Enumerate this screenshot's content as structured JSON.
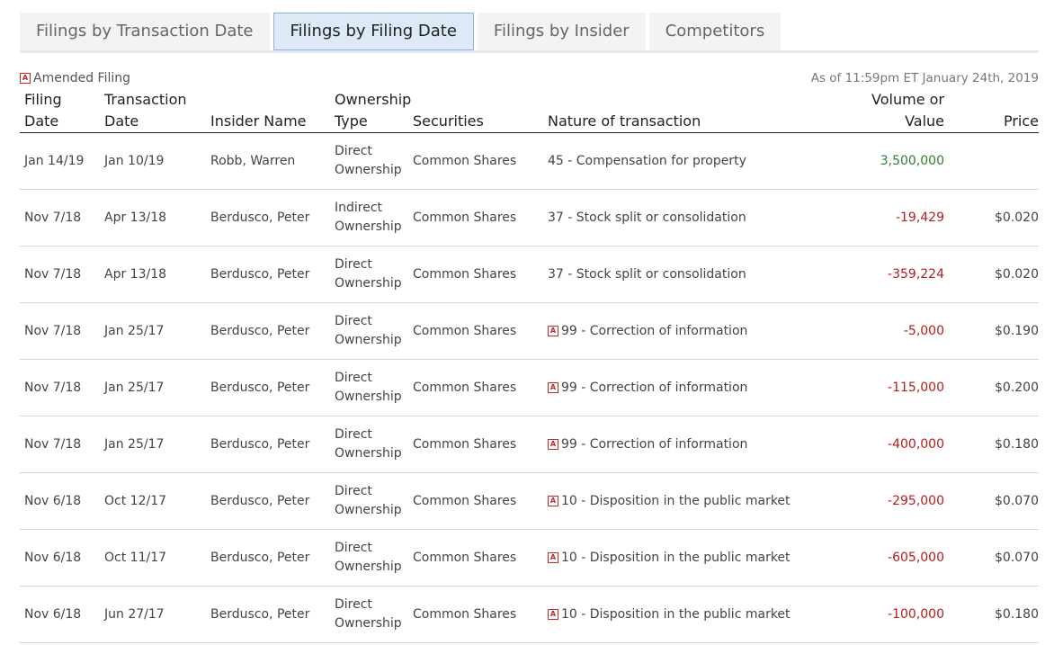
{
  "tabs": [
    {
      "label": "Filings by Transaction Date",
      "active": false
    },
    {
      "label": "Filings by Filing Date",
      "active": true
    },
    {
      "label": "Filings by Insider",
      "active": false
    },
    {
      "label": "Competitors",
      "active": false
    }
  ],
  "legend": {
    "icon_letter": "A",
    "label": "Amended Filing"
  },
  "as_of": "As of 11:59pm ET January 24th, 2019",
  "columns": {
    "filing_date": [
      "Filing",
      "Date"
    ],
    "transaction_date": [
      "Transaction",
      "Date"
    ],
    "insider_name": "Insider Name",
    "ownership_type": [
      "Ownership",
      "Type"
    ],
    "securities": "Securities",
    "nature": "Nature of transaction",
    "volume": [
      "Volume or",
      "Value"
    ],
    "price": "Price"
  },
  "colors": {
    "positive": "#2e7d32",
    "negative": "#b71c1c",
    "amended_icon": "#c62828",
    "active_tab_bg": "#dde9f6"
  },
  "rows": [
    {
      "filing_date": "Jan 14/19",
      "transaction_date": "Jan 10/19",
      "insider": "Robb, Warren",
      "own1": "Direct",
      "own2": "Ownership",
      "securities": "Common Shares",
      "amended": false,
      "nature": "45 - Compensation for property",
      "volume": "3,500,000",
      "sign": "pos",
      "price": ""
    },
    {
      "filing_date": "Nov 7/18",
      "transaction_date": "Apr 13/18",
      "insider": "Berdusco, Peter",
      "own1": "Indirect",
      "own2": "Ownership",
      "securities": "Common Shares",
      "amended": false,
      "nature": "37 - Stock split or consolidation",
      "volume": "-19,429",
      "sign": "neg",
      "price": "$0.020"
    },
    {
      "filing_date": "Nov 7/18",
      "transaction_date": "Apr 13/18",
      "insider": "Berdusco, Peter",
      "own1": "Direct",
      "own2": "Ownership",
      "securities": "Common Shares",
      "amended": false,
      "nature": "37 - Stock split or consolidation",
      "volume": "-359,224",
      "sign": "neg",
      "price": "$0.020"
    },
    {
      "filing_date": "Nov 7/18",
      "transaction_date": "Jan 25/17",
      "insider": "Berdusco, Peter",
      "own1": "Direct",
      "own2": "Ownership",
      "securities": "Common Shares",
      "amended": true,
      "nature": "99 - Correction of information",
      "volume": "-5,000",
      "sign": "neg",
      "price": "$0.190"
    },
    {
      "filing_date": "Nov 7/18",
      "transaction_date": "Jan 25/17",
      "insider": "Berdusco, Peter",
      "own1": "Direct",
      "own2": "Ownership",
      "securities": "Common Shares",
      "amended": true,
      "nature": "99 - Correction of information",
      "volume": "-115,000",
      "sign": "neg",
      "price": "$0.200"
    },
    {
      "filing_date": "Nov 7/18",
      "transaction_date": "Jan 25/17",
      "insider": "Berdusco, Peter",
      "own1": "Direct",
      "own2": "Ownership",
      "securities": "Common Shares",
      "amended": true,
      "nature": "99 - Correction of information",
      "volume": "-400,000",
      "sign": "neg",
      "price": "$0.180"
    },
    {
      "filing_date": "Nov 6/18",
      "transaction_date": "Oct 12/17",
      "insider": "Berdusco, Peter",
      "own1": "Direct",
      "own2": "Ownership",
      "securities": "Common Shares",
      "amended": true,
      "nature": "10 - Disposition in the public market",
      "volume": "-295,000",
      "sign": "neg",
      "price": "$0.070"
    },
    {
      "filing_date": "Nov 6/18",
      "transaction_date": "Oct 11/17",
      "insider": "Berdusco, Peter",
      "own1": "Direct",
      "own2": "Ownership",
      "securities": "Common Shares",
      "amended": true,
      "nature": "10 - Disposition in the public market",
      "volume": "-605,000",
      "sign": "neg",
      "price": "$0.070"
    },
    {
      "filing_date": "Nov 6/18",
      "transaction_date": "Jun 27/17",
      "insider": "Berdusco, Peter",
      "own1": "Direct",
      "own2": "Ownership",
      "securities": "Common Shares",
      "amended": true,
      "nature": "10 - Disposition in the public market",
      "volume": "-100,000",
      "sign": "neg",
      "price": "$0.180"
    }
  ]
}
